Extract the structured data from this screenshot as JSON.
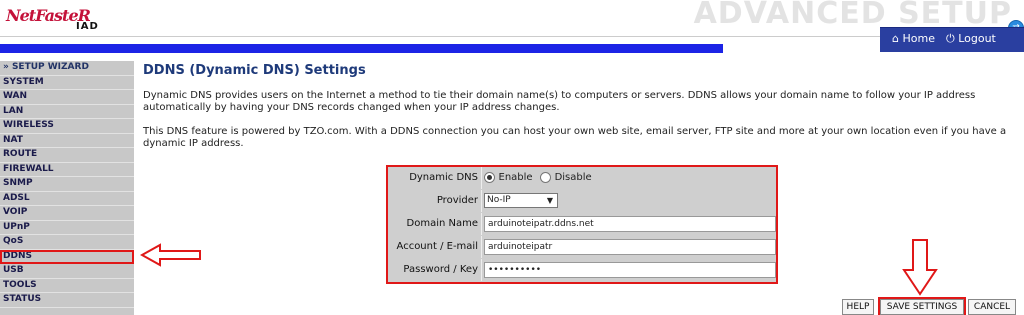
{
  "header": {
    "logo_main": "NetFasteR",
    "logo_sub": "IAD",
    "section_title": "ADVANCED SETUP",
    "home_link": "Home",
    "logout_link": "Logout"
  },
  "sidebar": {
    "items": [
      {
        "label": "» SETUP WIZARD"
      },
      {
        "label": "SYSTEM"
      },
      {
        "label": "WAN"
      },
      {
        "label": "LAN"
      },
      {
        "label": "WIRELESS"
      },
      {
        "label": "NAT"
      },
      {
        "label": "ROUTE"
      },
      {
        "label": "FIREWALL"
      },
      {
        "label": "SNMP"
      },
      {
        "label": "ADSL"
      },
      {
        "label": "VOIP"
      },
      {
        "label": "UPnP"
      },
      {
        "label": "QoS"
      },
      {
        "label": "DDNS"
      },
      {
        "label": "USB"
      },
      {
        "label": "TOOLS"
      },
      {
        "label": "STATUS"
      }
    ],
    "active": "DDNS"
  },
  "main": {
    "title": "DDNS (Dynamic DNS) Settings",
    "para1": "Dynamic DNS provides users on the Internet a method to tie their domain name(s) to computers or servers. DDNS allows your domain name to follow your IP address automatically by having your DNS records changed when your IP address changes.",
    "para2": "This DNS feature is powered by TZO.com. With a DDNS connection you can host your own web site, email server, FTP site and more at your own location even if you have a dynamic IP address."
  },
  "form": {
    "dynamic_dns_label": "Dynamic DNS",
    "enable_label": "Enable",
    "disable_label": "Disable",
    "dynamic_dns_value": "Enable",
    "provider_label": "Provider",
    "provider_value": "No-IP",
    "domain_label": "Domain Name",
    "domain_value": "arduinoteipatr.ddns.net",
    "account_label": "Account / E-mail",
    "account_value": "arduinoteipatr",
    "password_label": "Password / Key",
    "password_value": "••••••••••"
  },
  "buttons": {
    "help": "HELP",
    "save": "SAVE SETTINGS",
    "cancel": "CANCEL"
  },
  "colors": {
    "accent_blue": "#1c24e6",
    "highlight_red": "#e01818",
    "sidebar_bg": "#c8c8c8",
    "title_blue": "#1e3a7a"
  }
}
